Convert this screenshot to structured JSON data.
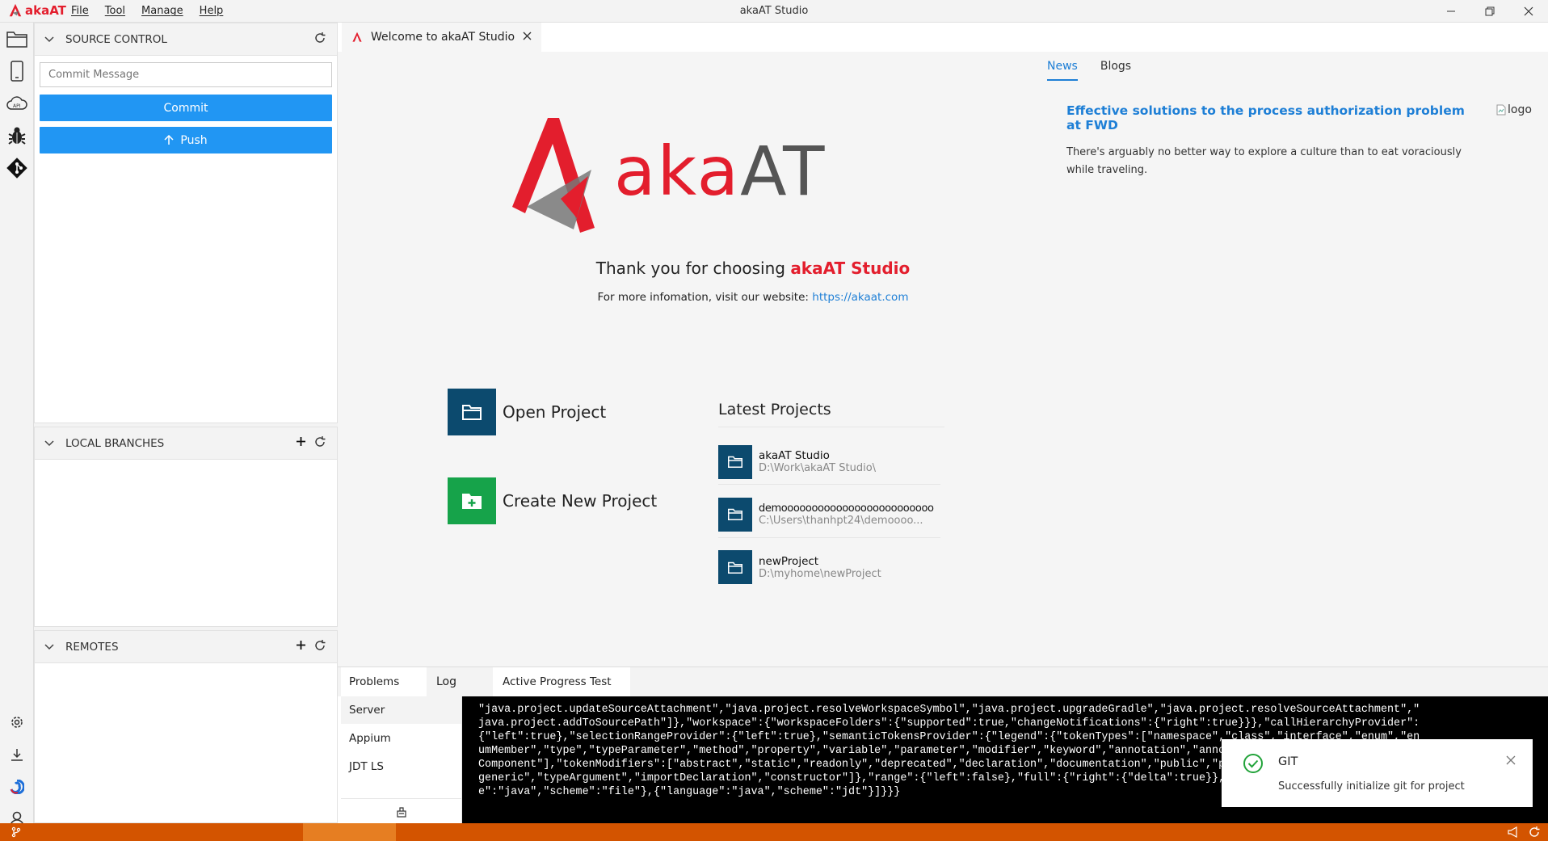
{
  "app": {
    "logo_text": "akaAT",
    "window_title": "akaAT Studio",
    "menu": [
      "File",
      "Tool",
      "Manage",
      "Help"
    ]
  },
  "sidebar": {
    "source_control": {
      "title": "SOURCE CONTROL",
      "commit_placeholder": "Commit Message",
      "commit_label": "Commit",
      "push_label": "Push"
    },
    "local_branches": {
      "title": "LOCAL BRANCHES"
    },
    "remotes": {
      "title": "REMOTES"
    }
  },
  "editor": {
    "tab_label": "Welcome to akaAT Studio",
    "welcome": {
      "brand": "akaAT",
      "thank_prefix": "Thank you for choosing ",
      "thank_brand": "akaAT Studio",
      "info_prefix": "For more infomation, visit our website: ",
      "website": "https://akaat.com",
      "open_project": "Open Project",
      "create_project": "Create New Project",
      "latest_title": "Latest Projects",
      "projects": [
        {
          "name": "akaAT Studio",
          "path": "D:\\Work\\akaAT Studio\\"
        },
        {
          "name": "demooooooooooooooooooooooooo",
          "path": "C:\\Users\\thanhpt24\\demoooo..."
        },
        {
          "name": "newProject",
          "path": "D:\\myhome\\newProject"
        }
      ]
    },
    "news": {
      "tabs": [
        "News",
        "Blogs"
      ],
      "headline": "Effective solutions to the process authorization problem at FWD",
      "image_alt": "logo",
      "body_line1": "There's arguably no better way to explore a culture than to eat voraciously",
      "body_line2": "while traveling."
    }
  },
  "bottom_panel": {
    "tabs": [
      "Problems",
      "Log",
      "Active Progress Test"
    ],
    "sources": [
      "Server",
      "Appium",
      "JDT LS"
    ],
    "console_lines": [
      "\"java.project.updateSourceAttachment\",\"java.project.resolveWorkspaceSymbol\",\"java.project.upgradeGradle\",\"java.project.resolveSourceAttachment\",\"",
      "java.project.addToSourcePath\"]},\"workspace\":{\"workspaceFolders\":{\"supported\":true,\"changeNotifications\":{\"right\":true}}},\"callHierarchyProvider\":",
      "{\"left\":true},\"selectionRangeProvider\":{\"left\":true},\"semanticTokensProvider\":{\"legend\":{\"tokenTypes\":[\"namespace\",\"class\",\"interface\",\"enum\",\"en",
      "umMember\",\"type\",\"typeParameter\",\"method\",\"property\",\"variable\",\"parameter\",\"modifier\",\"keyword\",\"annotation\",\"annotationMember\",\"record\",\"record",
      "Component\"],\"tokenModifiers\":[\"abstract\",\"static\",\"readonly\",\"deprecated\",\"declaration\",\"documentation\",\"public\",\"private\",\"protected\",\"native\",\"",
      "generic\",\"typeArgument\",\"importDeclaration\",\"constructor\"]},\"range\":{\"left\":false},\"full\":{\"right\":{\"delta\":true}},\"documentSelector\":[{\"languag",
      "e\":\"java\",\"scheme\":\"file\"},{\"language\":\"java\",\"scheme\":\"jdt\"}]}}}"
    ]
  },
  "toast": {
    "title": "GIT",
    "message": "Successfully initialize git for project"
  },
  "colors": {
    "brand_red": "#e31e2d",
    "primary_blue": "#2196f3",
    "status_orange": "#d35400",
    "folder_navy": "#0c4a6e",
    "create_green": "#16a34a"
  }
}
